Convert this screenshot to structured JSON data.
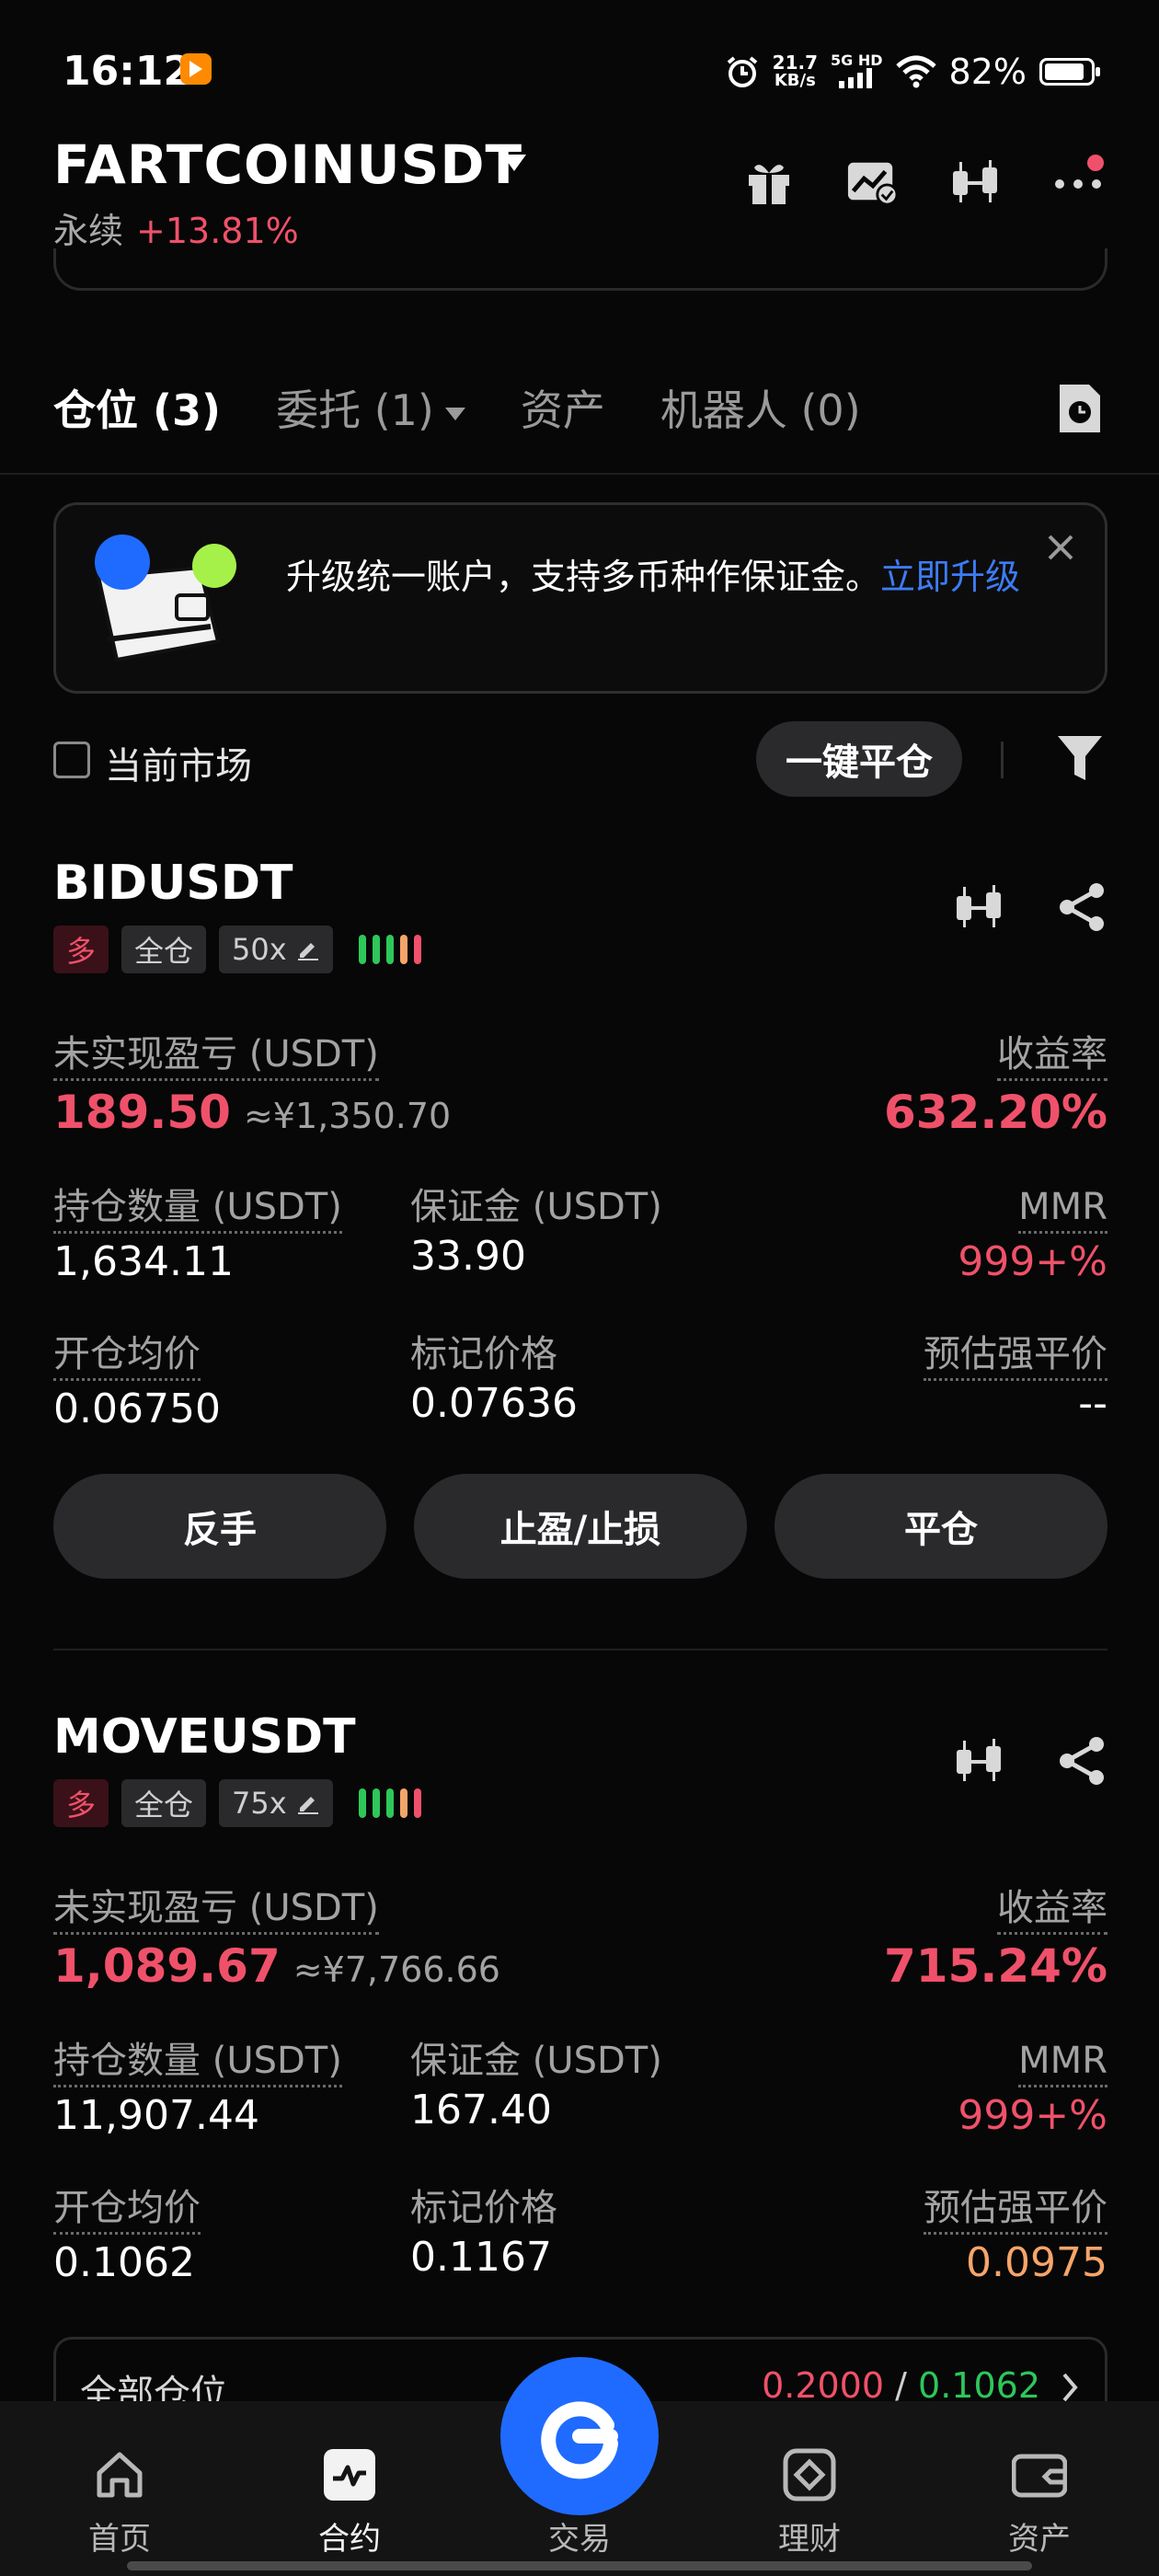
{
  "status_bar": {
    "time": "16:12",
    "speed_value": "21.7",
    "speed_unit": "KB/s",
    "network": "5G HD",
    "battery": "82%"
  },
  "header": {
    "pair": "FARTCOINUSDT",
    "contract_type": "永续",
    "change": "+13.81%"
  },
  "tabs": [
    {
      "label": "仓位 (3)"
    },
    {
      "label": "委托 (1)"
    },
    {
      "label": "资产"
    },
    {
      "label": "机器人 (0)"
    }
  ],
  "banner": {
    "text": "升级统一账户，支持多币种作保证金。",
    "link": "立即升级"
  },
  "filter": {
    "current_market": "当前市场",
    "close_all": "一键平仓"
  },
  "labels": {
    "unrealized_pnl": "未实现盈亏 (USDT)",
    "roe": "收益率",
    "position_size": "持仓数量 (USDT)",
    "margin": "保证金 (USDT)",
    "mmr": "MMR",
    "entry_price": "开仓均价",
    "mark_price": "标记价格",
    "liq_price": "预估强平价"
  },
  "positions": [
    {
      "symbol": "BIDUSDT",
      "side": "多",
      "margin_mode": "全仓",
      "leverage": "50x",
      "pnl": "189.50",
      "pnl_cny": "≈¥1,350.70",
      "roe": "632.20%",
      "size": "1,634.11",
      "margin": "33.90",
      "mmr": "999+%",
      "entry": "0.06750",
      "mark": "0.07636",
      "liq": "--",
      "buttons": [
        "反手",
        "止盈/止损",
        "平仓"
      ]
    },
    {
      "symbol": "MOVEUSDT",
      "side": "多",
      "margin_mode": "全仓",
      "leverage": "75x",
      "pnl": "1,089.67",
      "pnl_cny": "≈¥7,766.66",
      "roe": "715.24%",
      "size": "11,907.44",
      "margin": "167.40",
      "mmr": "999+%",
      "entry": "0.1062",
      "mark": "0.1167",
      "liq": "0.0975"
    }
  ],
  "all_positions": {
    "label": "全部仓位",
    "value_red": "0.2000",
    "slash": "/",
    "value_green": "0.1062"
  },
  "bottom_nav": [
    {
      "label": "首页",
      "icon": "home-icon"
    },
    {
      "label": "合约",
      "icon": "futures-icon"
    },
    {
      "label": "交易",
      "icon": "trade-icon"
    },
    {
      "label": "理财",
      "icon": "earn-icon"
    },
    {
      "label": "资产",
      "icon": "wallet-icon"
    }
  ],
  "colors": {
    "red": "#f0516a",
    "green": "#2ec75a",
    "orange": "#f6a56a",
    "blue": "#1f6bff",
    "link": "#3d7cf5"
  }
}
